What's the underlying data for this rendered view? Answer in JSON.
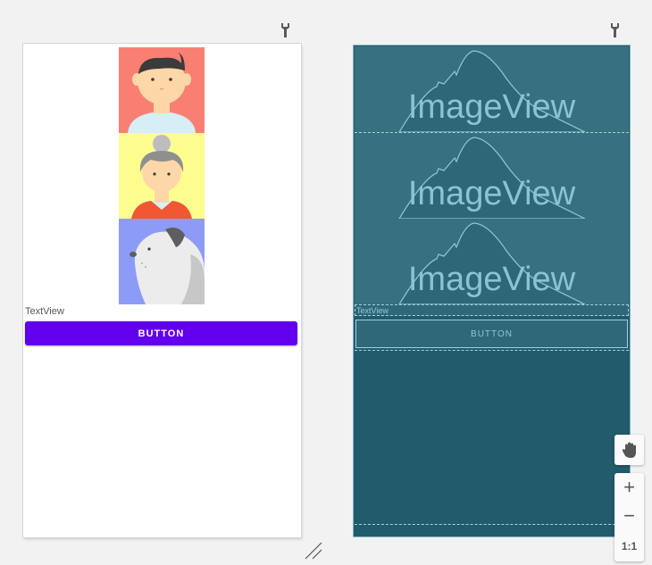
{
  "icons": {
    "design_settings": "wrench-icon",
    "blueprint_settings": "wrench-icon",
    "pan": "hand-icon",
    "resize": "resize-handle-icon"
  },
  "design": {
    "images": [
      {
        "name": "boy-avatar",
        "background": "#f97f73"
      },
      {
        "name": "grandma-avatar",
        "background": "#fdfc8f"
      },
      {
        "name": "dog-avatar",
        "background": "#8c9cf6"
      }
    ],
    "textview": "TextView",
    "button": "BUTTON"
  },
  "blueprint": {
    "image_labels": [
      "ImageView",
      "ImageView",
      "ImageView"
    ],
    "textview": "TextView",
    "button": "BUTTON"
  },
  "zoom": {
    "in": "+",
    "out": "−",
    "fit": "1:1"
  },
  "colors": {
    "accent": "#6200ee",
    "blueprint_bg": "#225b6c"
  }
}
